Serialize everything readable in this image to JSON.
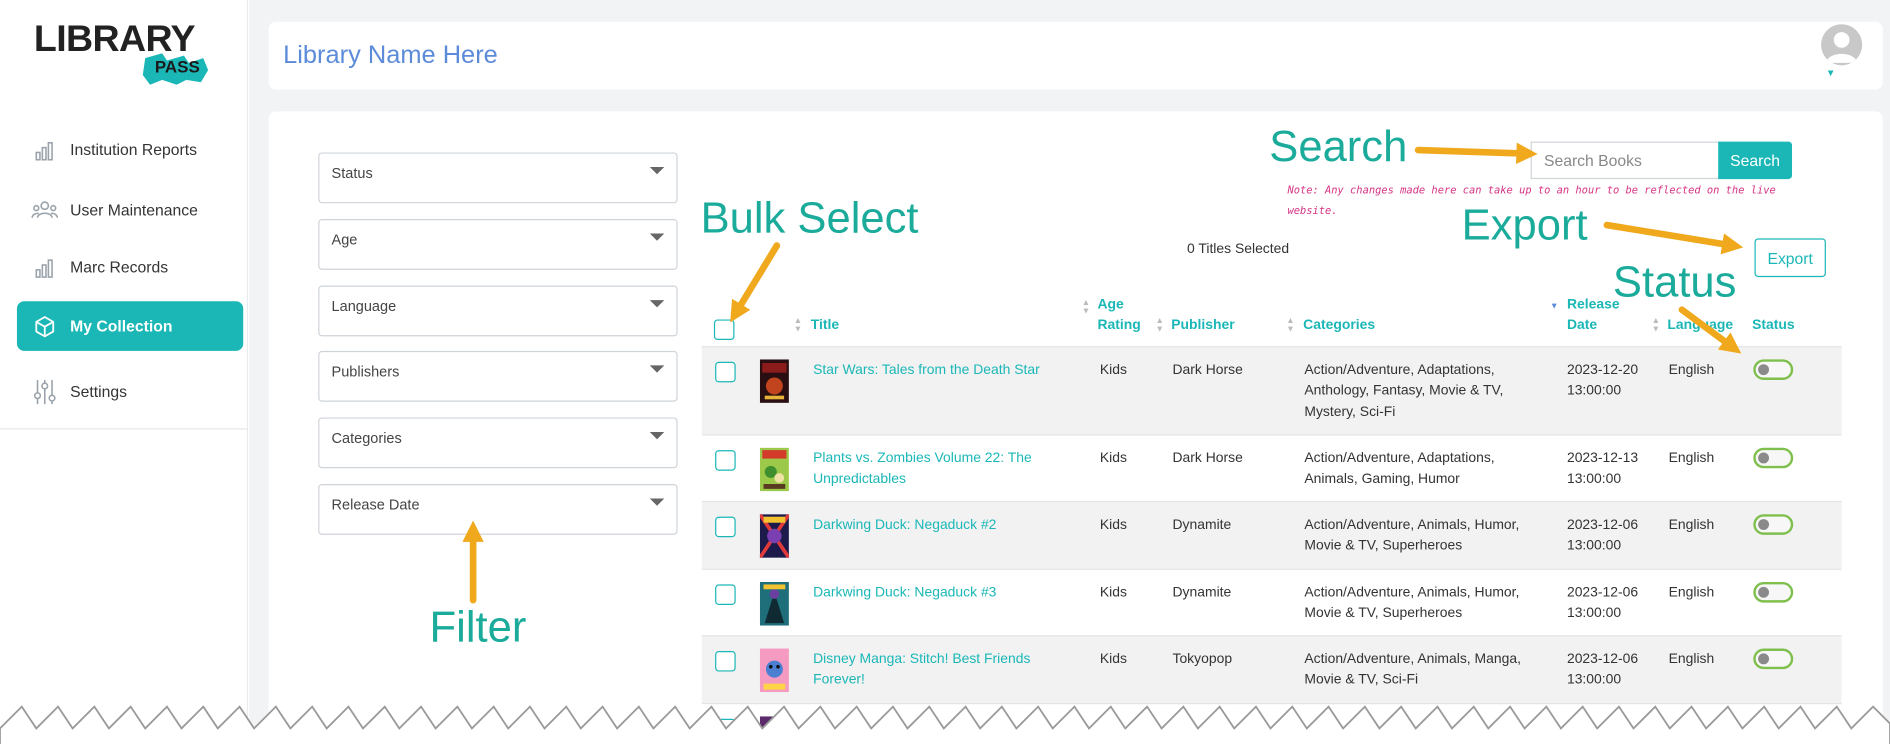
{
  "app": {
    "logo_text": "LIBRARY",
    "logo_sub": "PASS",
    "library_name": "Library Name Here"
  },
  "sidebar": {
    "items": [
      {
        "label": "Institution Reports",
        "icon": "bar-chart-icon"
      },
      {
        "label": "User Maintenance",
        "icon": "users-icon"
      },
      {
        "label": "Marc Records",
        "icon": "bar-chart-icon"
      },
      {
        "label": "My Collection",
        "icon": "box-icon",
        "active": true
      },
      {
        "label": "Settings",
        "icon": "sliders-icon"
      }
    ]
  },
  "filters": [
    "Status",
    "Age",
    "Language",
    "Publishers",
    "Categories",
    "Release Date"
  ],
  "search": {
    "placeholder": "Search Books",
    "button": "Search"
  },
  "note": "Note: Any changes made here can take up to an hour to be reflected on the live website.",
  "selected_count": "0 Titles Selected",
  "export_label": "Export",
  "table": {
    "headers": {
      "title": "Title",
      "age_1": "Age",
      "age_2": "Rating",
      "publisher": "Publisher",
      "categories": "Categories",
      "release_1": "Release",
      "release_2": "Date",
      "language": "Language",
      "status": "Status"
    },
    "rows": [
      {
        "title_1": "Star Wars: Tales from the Death Star",
        "title_2": "",
        "age": "Kids",
        "publisher": "Dark Horse",
        "cat_1": "Action/Adventure, Adaptations,",
        "cat_2": "Anthology, Fantasy, Movie & TV,",
        "cat_3": "Mystery, Sci-Fi",
        "date_1": "2023-12-20",
        "date_2": "13:00:00",
        "language": "English",
        "status_on": false
      },
      {
        "title_1": "Plants vs. Zombies Volume 22: The",
        "title_2": "Unpredictables",
        "age": "Kids",
        "publisher": "Dark Horse",
        "cat_1": "Action/Adventure, Adaptations,",
        "cat_2": "Animals, Gaming, Humor",
        "cat_3": "",
        "date_1": "2023-12-13",
        "date_2": "13:00:00",
        "language": "English",
        "status_on": false
      },
      {
        "title_1": "Darkwing Duck: Negaduck #2",
        "title_2": "",
        "age": "Kids",
        "publisher": "Dynamite",
        "cat_1": "Action/Adventure, Animals, Humor,",
        "cat_2": "Movie & TV, Superheroes",
        "cat_3": "",
        "date_1": "2023-12-06",
        "date_2": "13:00:00",
        "language": "English",
        "status_on": false
      },
      {
        "title_1": "Darkwing Duck: Negaduck #3",
        "title_2": "",
        "age": "Kids",
        "publisher": "Dynamite",
        "cat_1": "Action/Adventure, Animals, Humor,",
        "cat_2": "Movie & TV, Superheroes",
        "cat_3": "",
        "date_1": "2023-12-06",
        "date_2": "13:00:00",
        "language": "English",
        "status_on": false
      },
      {
        "title_1": "Disney Manga: Stitch! Best Friends",
        "title_2": "Forever!",
        "age": "Kids",
        "publisher": "Tokyopop",
        "cat_1": "Action/Adventure, Animals, Manga,",
        "cat_2": "Movie & TV, Sci-Fi",
        "cat_3": "",
        "date_1": "2023-12-06",
        "date_2": "13:00:00",
        "language": "English",
        "status_on": false
      }
    ]
  },
  "annotations": {
    "search": "Search",
    "bulk_select": "Bulk Select",
    "export": "Export",
    "status": "Status",
    "filter": "Filter"
  },
  "colors": {
    "accent": "#1bb7b7",
    "annotation": "#1aab9b",
    "arrow": "#f0a81c",
    "note": "#d63384",
    "library_name": "#5b8bd9"
  }
}
